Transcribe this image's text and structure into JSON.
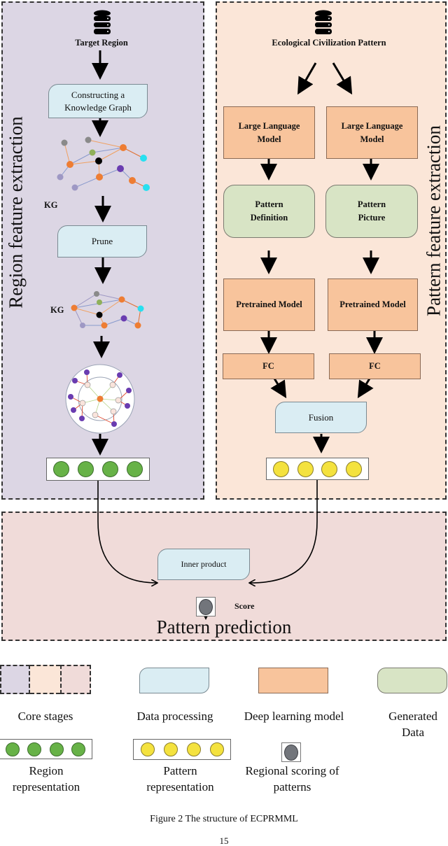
{
  "panels": {
    "region": {
      "title": "Region feature extraction",
      "source_label": "Target Region",
      "construct_kg": "Constructing a Knowledge Graph",
      "kg_label_1": "KG",
      "prune": "Prune",
      "kg_label_2": "KG",
      "output_vector_dots": 4
    },
    "pattern": {
      "title": "Pattern feature extraction",
      "source_label": "Ecological Civilization Pattern",
      "llm_left": "Large Language Model",
      "llm_right": "Large Language Model",
      "gen_left": "Pattern Definition",
      "gen_right": "Pattern Picture",
      "pretrained_left": "Pretrained Model",
      "pretrained_right": "Pretrained Model",
      "fc_left": "FC",
      "fc_right": "FC",
      "fusion": "Fusion",
      "output_vector_dots": 4
    },
    "prediction": {
      "title": "Pattern prediction",
      "inner_product": "Inner product",
      "score_label": "Score"
    }
  },
  "legend": {
    "core_stages": "Core stages",
    "data_processing": "Data processing",
    "deep_learning_model": "Deep learning model",
    "generated_data": "Generated Data",
    "region_representation": "Region representation",
    "pattern_representation": "Pattern representation",
    "regional_scoring": "Regional scoring of patterns"
  },
  "caption": "Figure 2 The structure of ECPRMML",
  "page_number": "15",
  "colors": {
    "region_panel": "#dcd6e4",
    "pattern_panel": "#fbe6d8",
    "prediction_panel": "#f0dbd9",
    "data_processing": "#daedf3",
    "deep_learning": "#f8c49c",
    "generated_data": "#d8e4c5",
    "region_vector": "#67b247",
    "pattern_vector": "#f4e23e",
    "score": "#72757b"
  }
}
